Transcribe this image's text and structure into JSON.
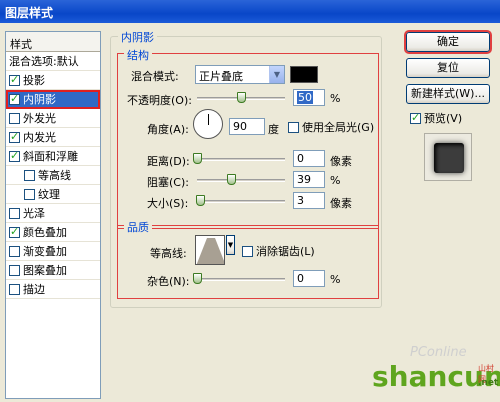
{
  "window": {
    "title": "图层样式"
  },
  "styles": {
    "header": "样式",
    "items": [
      {
        "label": "混合选项:默认",
        "checkbox": false,
        "checked": false,
        "sub": false,
        "selected": false
      },
      {
        "label": "投影",
        "checkbox": true,
        "checked": true,
        "sub": false,
        "selected": false
      },
      {
        "label": "内阴影",
        "checkbox": true,
        "checked": true,
        "sub": false,
        "selected": true
      },
      {
        "label": "外发光",
        "checkbox": true,
        "checked": false,
        "sub": false,
        "selected": false
      },
      {
        "label": "内发光",
        "checkbox": true,
        "checked": true,
        "sub": false,
        "selected": false
      },
      {
        "label": "斜面和浮雕",
        "checkbox": true,
        "checked": true,
        "sub": false,
        "selected": false
      },
      {
        "label": "等高线",
        "checkbox": true,
        "checked": false,
        "sub": true,
        "selected": false
      },
      {
        "label": "纹理",
        "checkbox": true,
        "checked": false,
        "sub": true,
        "selected": false
      },
      {
        "label": "光泽",
        "checkbox": true,
        "checked": false,
        "sub": false,
        "selected": false
      },
      {
        "label": "颜色叠加",
        "checkbox": true,
        "checked": true,
        "sub": false,
        "selected": false
      },
      {
        "label": "渐变叠加",
        "checkbox": true,
        "checked": false,
        "sub": false,
        "selected": false
      },
      {
        "label": "图案叠加",
        "checkbox": true,
        "checked": false,
        "sub": false,
        "selected": false
      },
      {
        "label": "描边",
        "checkbox": true,
        "checked": false,
        "sub": false,
        "selected": false
      }
    ]
  },
  "panel": {
    "title": "内阴影",
    "structure": {
      "title": "结构",
      "blend_mode_label": "混合模式:",
      "blend_mode_value": "正片叠底",
      "blend_color": "#000000",
      "opacity_label": "不透明度(O):",
      "opacity_value": "50",
      "opacity_unit": "%",
      "angle_label": "角度(A):",
      "angle_value": "90",
      "angle_unit": "度",
      "global_light_label": "使用全局光(G)",
      "global_light_checked": false,
      "distance_label": "距离(D):",
      "distance_value": "0",
      "distance_unit": "像素",
      "choke_label": "阻塞(C):",
      "choke_value": "39",
      "choke_unit": "%",
      "size_label": "大小(S):",
      "size_value": "3",
      "size_unit": "像素"
    },
    "quality": {
      "title": "品质",
      "contour_label": "等高线:",
      "antialias_label": "消除锯齿(L)",
      "antialias_checked": false,
      "noise_label": "杂色(N):",
      "noise_value": "0",
      "noise_unit": "%"
    }
  },
  "buttons": {
    "ok": "确定",
    "reset": "复位",
    "new_style": "新建样式(W)...",
    "preview_label": "预览(V)",
    "preview_checked": true
  },
  "watermark": {
    "pconline": "PConline",
    "shancun": "shancun",
    "suffix": "山村网",
    "net": ".net"
  }
}
